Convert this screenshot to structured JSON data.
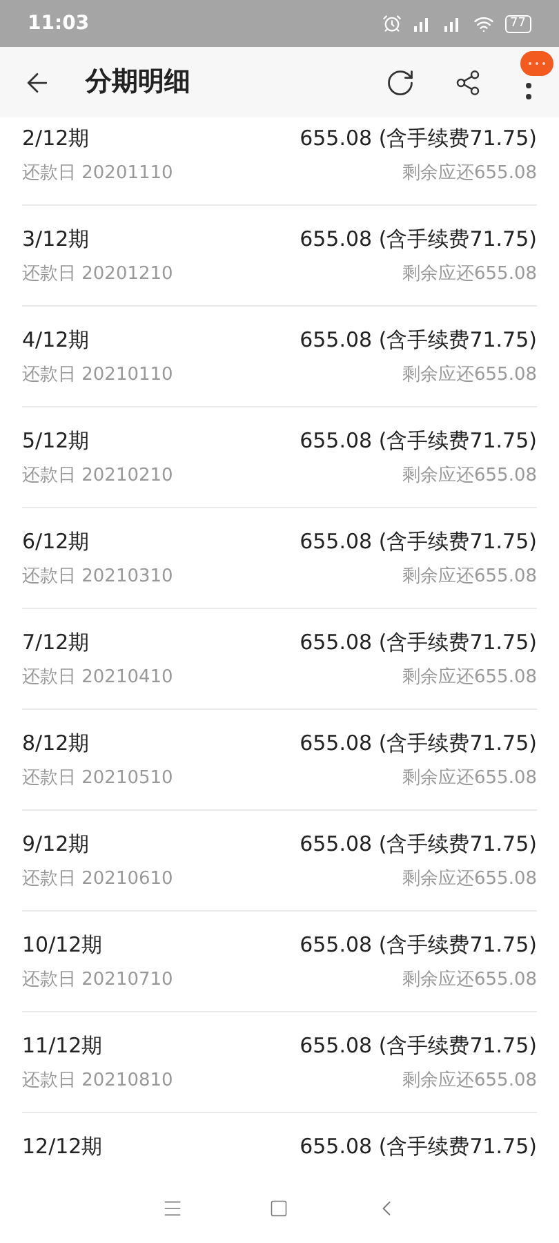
{
  "status_bar": {
    "time": "11:03",
    "battery": "77"
  },
  "header": {
    "title": "分期明细"
  },
  "installments": [
    {
      "period": "2/12期",
      "amount": "655.08 (含手续费71.75)",
      "due_date": "还款日 20201110",
      "remaining": "剩余应还655.08"
    },
    {
      "period": "3/12期",
      "amount": "655.08 (含手续费71.75)",
      "due_date": "还款日 20201210",
      "remaining": "剩余应还655.08"
    },
    {
      "period": "4/12期",
      "amount": "655.08 (含手续费71.75)",
      "due_date": "还款日 20210110",
      "remaining": "剩余应还655.08"
    },
    {
      "period": "5/12期",
      "amount": "655.08 (含手续费71.75)",
      "due_date": "还款日 20210210",
      "remaining": "剩余应还655.08"
    },
    {
      "period": "6/12期",
      "amount": "655.08 (含手续费71.75)",
      "due_date": "还款日 20210310",
      "remaining": "剩余应还655.08"
    },
    {
      "period": "7/12期",
      "amount": "655.08 (含手续费71.75)",
      "due_date": "还款日 20210410",
      "remaining": "剩余应还655.08"
    },
    {
      "period": "8/12期",
      "amount": "655.08 (含手续费71.75)",
      "due_date": "还款日 20210510",
      "remaining": "剩余应还655.08"
    },
    {
      "period": "9/12期",
      "amount": "655.08 (含手续费71.75)",
      "due_date": "还款日 20210610",
      "remaining": "剩余应还655.08"
    },
    {
      "period": "10/12期",
      "amount": "655.08 (含手续费71.75)",
      "due_date": "还款日 20210710",
      "remaining": "剩余应还655.08"
    },
    {
      "period": "11/12期",
      "amount": "655.08 (含手续费71.75)",
      "due_date": "还款日 20210810",
      "remaining": "剩余应还655.08"
    },
    {
      "period": "12/12期",
      "amount": "655.08 (含手续费71.75)"
    }
  ]
}
